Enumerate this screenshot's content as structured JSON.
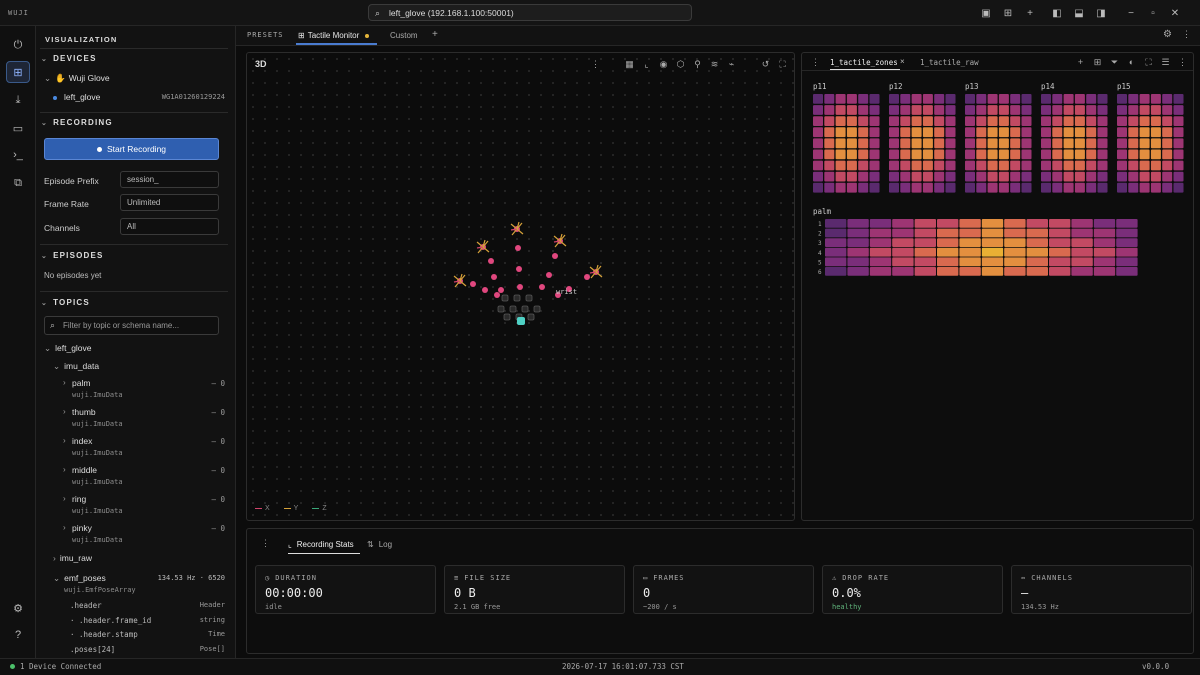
{
  "app": {
    "name": "WUJI"
  },
  "address": {
    "value": "left_glove (192.168.1.100:50001)"
  },
  "window_icons": [
    "panel-layout-icon",
    "grid-icon",
    "plus-icon",
    "sidebar-left-icon",
    "panel-bottom-icon",
    "sidebar-right-icon",
    "minimize-icon",
    "maximize-icon",
    "close-icon"
  ],
  "rail": [
    "plug-icon",
    "visualization-icon",
    "download-icon",
    "folder-icon",
    "terminal-icon",
    "extensions-icon",
    "settings-icon",
    "help-icon"
  ],
  "sidebar": {
    "title": "VISUALIZATION",
    "devices": {
      "heading": "DEVICES",
      "group": "Wuji Glove",
      "device": "left_glove",
      "serial": "WG1A01260129224"
    },
    "recording": {
      "heading": "RECORDING",
      "start_label": "Start Recording",
      "prefix_label": "Episode Prefix",
      "prefix_value": "session_",
      "rate_label": "Frame Rate",
      "rate_value": "Unlimited",
      "channels_label": "Channels",
      "channels_value": "All"
    },
    "episodes": {
      "heading": "EPISODES",
      "empty": "No episodes yet"
    },
    "topics": {
      "heading": "TOPICS",
      "filter_placeholder": "Filter by topic or schema name...",
      "root": "left_glove",
      "imu_group": "imu_data",
      "imu_items": [
        {
          "name": "palm",
          "schema": "wuji.ImuData",
          "count": "– 0"
        },
        {
          "name": "thumb",
          "schema": "wuji.ImuData",
          "count": "– 0"
        },
        {
          "name": "index",
          "schema": "wuji.ImuData",
          "count": "– 0"
        },
        {
          "name": "middle",
          "schema": "wuji.ImuData",
          "count": "– 0"
        },
        {
          "name": "ring",
          "schema": "wuji.ImuData",
          "count": "– 0"
        },
        {
          "name": "pinky",
          "schema": "wuji.ImuData",
          "count": "– 0"
        }
      ],
      "imu_raw": "imu_raw",
      "emf": {
        "name": "emf_poses",
        "rate": "134.53 Hz · 6520",
        "schema": "wuji.EmfPoseArray"
      },
      "fields": [
        {
          "name": ".header",
          "type": "Header"
        },
        {
          "name": "· .header.frame_id",
          "type": "string"
        },
        {
          "name": "· .header.stamp",
          "type": "Time"
        },
        {
          "name": ".poses[24]",
          "type": "Pose[]"
        }
      ]
    }
  },
  "tabs": {
    "presets": "PRESETS",
    "items": [
      "Tactile Monitor",
      "Custom"
    ],
    "add": "+"
  },
  "panel3d": {
    "title": "3D",
    "wrist_label": "wrist",
    "legend": [
      {
        "label": "X",
        "color": "#d0446b"
      },
      {
        "label": "Y",
        "color": "#d6a23a"
      },
      {
        "label": "Z",
        "color": "#3aa87a"
      }
    ]
  },
  "tactile": {
    "tabs": [
      "1_tactile_zones",
      "1_tactile_raw"
    ],
    "fingers": [
      "p11",
      "p12",
      "p13",
      "p14",
      "p15"
    ],
    "palm_label": "palm",
    "palm_rows": [
      "1",
      "2",
      "3",
      "4",
      "5",
      "6"
    ],
    "palette": [
      "#5a2a6e",
      "#7a2e7a",
      "#9d3573",
      "#c24a63",
      "#d96a4f",
      "#e38f3f",
      "#e9b034"
    ]
  },
  "bottom": {
    "tabs": [
      "Recording Stats",
      "Log"
    ],
    "cards": [
      {
        "label": "DURATION",
        "value": "00:00:00",
        "foot": "idle",
        "icon": "clock-icon"
      },
      {
        "label": "FILE SIZE",
        "value": "0 B",
        "foot": "2.1 GB free",
        "icon": "database-icon"
      },
      {
        "label": "FRAMES",
        "value": "0",
        "foot": "~200 / s",
        "icon": "frames-icon"
      },
      {
        "label": "DROP RATE",
        "value": "0.0%",
        "foot": "healthy",
        "icon": "alert-icon",
        "foot_color": "#5fb27a"
      },
      {
        "label": "CHANNELS",
        "value": "—",
        "foot": "134.53 Hz",
        "icon": "channels-icon"
      }
    ]
  },
  "status": {
    "connected": "1 Device Connected",
    "timestamp": "2026-07-17 16:01:07.733 CST",
    "version": "v0.0.0"
  }
}
